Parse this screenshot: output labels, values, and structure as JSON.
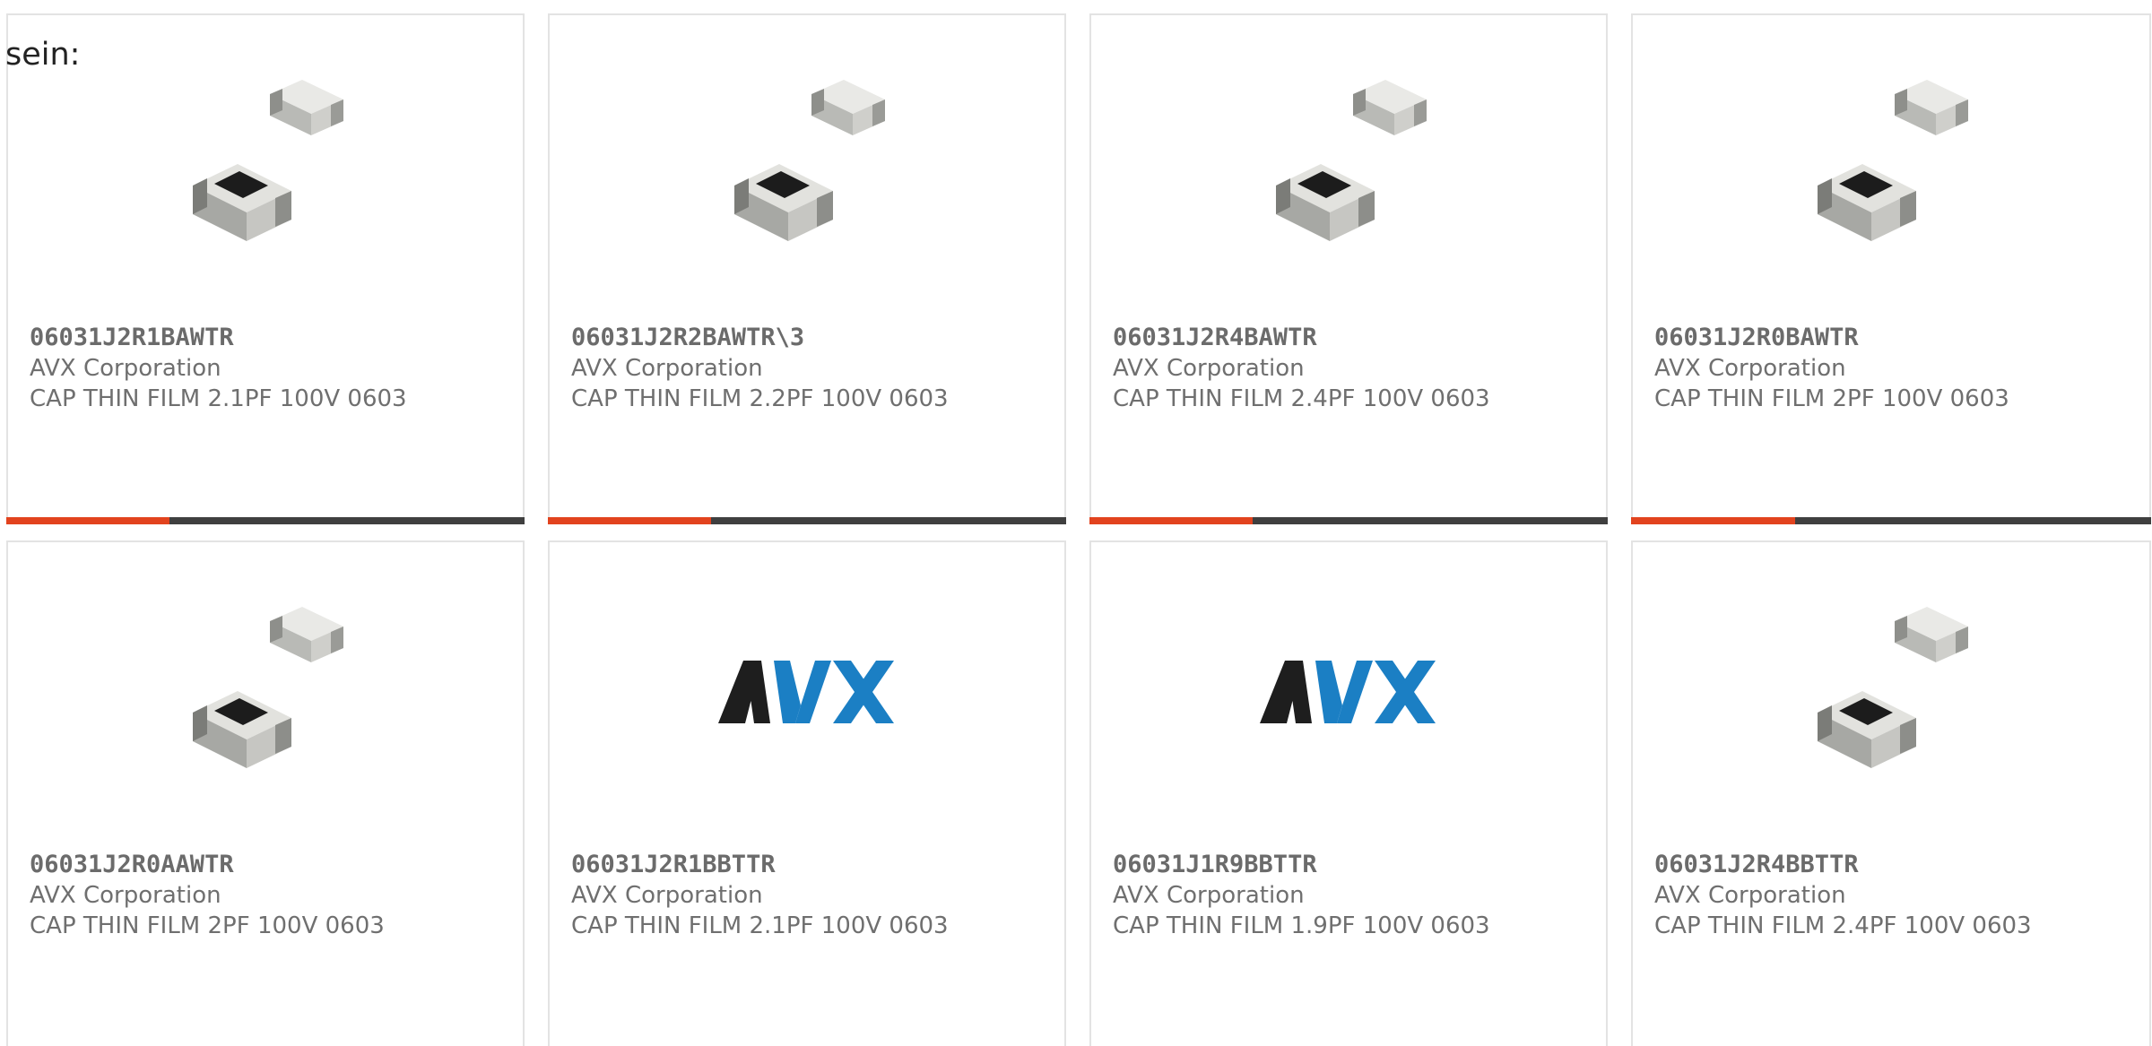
{
  "intro_text": "sein:",
  "colors": {
    "accent": "#e2431e",
    "bar_dark": "#3f3f3f",
    "avx_black": "#1e1e1e",
    "avx_blue": "#1b7fc4"
  },
  "products": [
    {
      "part": "06031J2R1BAWTR",
      "maker": "AVX Corporation",
      "desc": "CAP THIN FILM 2.1PF 100V 0603",
      "image": "chip-capacitor-photo",
      "accent_bar": true
    },
    {
      "part": "06031J2R2BAWTR\\3",
      "maker": "AVX Corporation",
      "desc": "CAP THIN FILM 2.2PF 100V 0603",
      "image": "chip-capacitor-photo",
      "accent_bar": true
    },
    {
      "part": "06031J2R4BAWTR",
      "maker": "AVX Corporation",
      "desc": "CAP THIN FILM 2.4PF 100V 0603",
      "image": "chip-capacitor-photo",
      "accent_bar": true
    },
    {
      "part": "06031J2R0BAWTR",
      "maker": "AVX Corporation",
      "desc": "CAP THIN FILM 2PF 100V 0603",
      "image": "chip-capacitor-photo",
      "accent_bar": true
    },
    {
      "part": "06031J2R0AAWTR",
      "maker": "AVX Corporation",
      "desc": "CAP THIN FILM 2PF 100V 0603",
      "image": "chip-capacitor-photo",
      "accent_bar": false
    },
    {
      "part": "06031J2R1BBTTR",
      "maker": "AVX Corporation",
      "desc": "CAP THIN FILM 2.1PF 100V 0603",
      "image": "avx-logo",
      "logo_text": "AVX",
      "accent_bar": false
    },
    {
      "part": "06031J1R9BBTTR",
      "maker": "AVX Corporation",
      "desc": "CAP THIN FILM 1.9PF 100V 0603",
      "image": "avx-logo",
      "logo_text": "AVX",
      "accent_bar": false
    },
    {
      "part": "06031J2R4BBTTR",
      "maker": "AVX Corporation",
      "desc": "CAP THIN FILM 2.4PF 100V 0603",
      "image": "chip-capacitor-photo",
      "accent_bar": false
    }
  ]
}
